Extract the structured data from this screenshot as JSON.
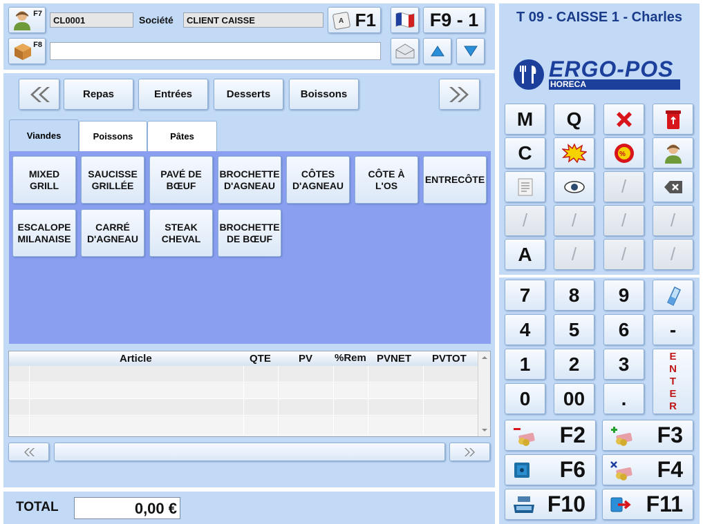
{
  "header": {
    "f7_label": "F7",
    "f8_label": "F8",
    "client_code": "CL0001",
    "societe_label": "Société",
    "societe_value": "CLIENT CAISSE",
    "f1_label": "F1",
    "f9_label": "F9 - 1",
    "search_value": ""
  },
  "terminal": {
    "title": "T 09 - CAISSE 1 - Charles",
    "logo_text": "ERGO-POS",
    "logo_sub": "HORECA"
  },
  "categories": [
    "Repas",
    "Entrées",
    "Desserts",
    "Boissons"
  ],
  "tabs": [
    "Viandes",
    "Poissons",
    "Pâtes"
  ],
  "products": [
    "MIXED\nGRILL",
    "SAUCISSE\nGRILLÉE",
    "PAVÉ DE\nBŒUF",
    "BROCHETTE\nD'AGNEAU",
    "CÔTES\nD'AGNEAU",
    "CÔTE À\nL'OS",
    "ENTRECÔTE",
    "ESCALOPE\nMILANAISE",
    "CARRÉ\nD'AGNEAU",
    "STEAK\nCHEVAL",
    "BROCHETTE\nDE BŒUF"
  ],
  "table": {
    "columns": [
      "Article",
      "QTE",
      "PV",
      "%Rem",
      "PVNET",
      "PVTOT"
    ]
  },
  "footer": {
    "total_label": "TOTAL",
    "total_value": "0,00 €"
  },
  "func_keys": {
    "m": "M",
    "q": "Q",
    "c": "C",
    "a": "A",
    "slash": "/"
  },
  "keypad": {
    "k7": "7",
    "k8": "8",
    "k9": "9",
    "k4": "4",
    "k5": "5",
    "k6": "6",
    "k1": "1",
    "k2": "2",
    "k3": "3",
    "k0": "0",
    "k00": "00",
    "kdot": ".",
    "minus": "-",
    "enter": "E\nN\nT\nE\nR"
  },
  "fkeys": {
    "f2": "F2",
    "f3": "F3",
    "f6": "F6",
    "f4": "F4",
    "f10": "F10",
    "f11": "F11"
  },
  "colors": {
    "panel": "#c2daf6",
    "product_area": "#8a9ff0",
    "title_blue": "#1a3a8a",
    "enter_red": "#c01818"
  }
}
